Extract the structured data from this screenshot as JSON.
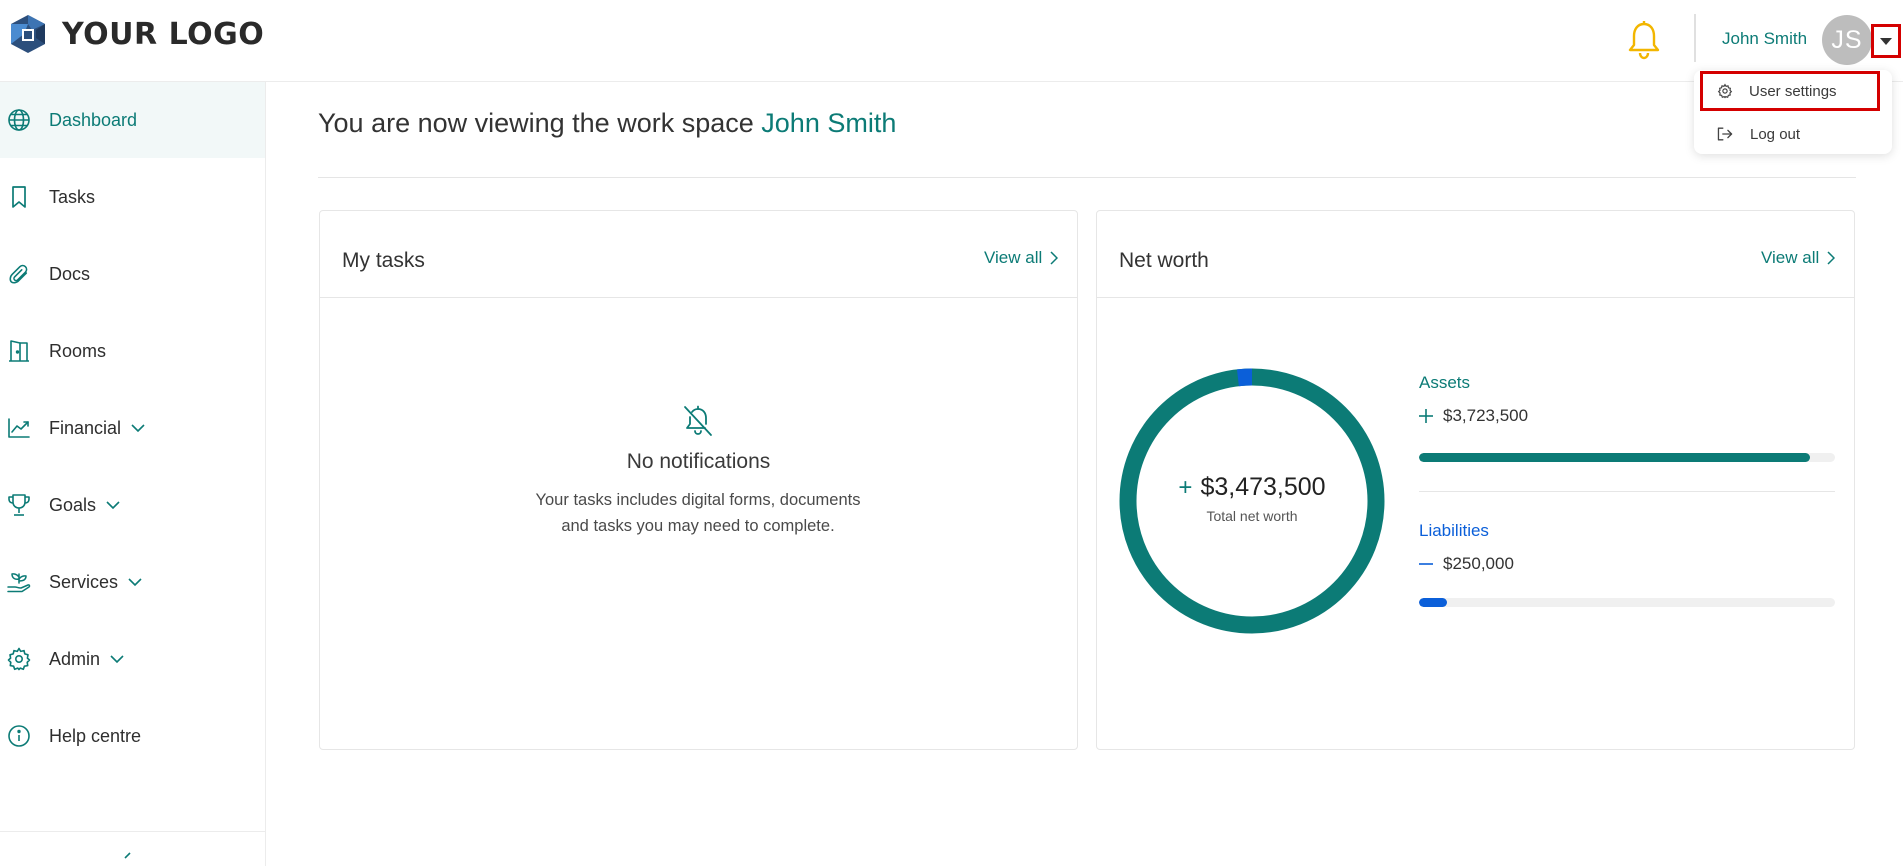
{
  "header": {
    "logo_text": "YOUR LOGO",
    "user_name": "John Smith",
    "avatar_initials": "JS"
  },
  "user_menu": {
    "items": [
      {
        "label": "User settings",
        "icon": "gear-icon"
      },
      {
        "label": "Log out",
        "icon": "logout-icon"
      }
    ]
  },
  "sidebar": {
    "items": [
      {
        "label": "Dashboard",
        "icon": "globe-icon",
        "active": true
      },
      {
        "label": "Tasks",
        "icon": "bookmark-icon"
      },
      {
        "label": "Docs",
        "icon": "paperclip-icon"
      },
      {
        "label": "Rooms",
        "icon": "door-icon"
      },
      {
        "label": "Financial",
        "icon": "chart-line-icon",
        "expandable": true
      },
      {
        "label": "Goals",
        "icon": "trophy-icon",
        "expandable": true
      },
      {
        "label": "Services",
        "icon": "hand-plant-icon",
        "expandable": true
      },
      {
        "label": "Admin",
        "icon": "gear-icon",
        "expandable": true
      },
      {
        "label": "Help centre",
        "icon": "info-icon"
      }
    ]
  },
  "main": {
    "title_prefix": "You are now viewing the work space",
    "workspace_name": "John Smith"
  },
  "tasks_card": {
    "title": "My tasks",
    "view_all": "View all",
    "empty_title": "No notifications",
    "empty_desc": "Your tasks includes digital forms, documents and tasks you may need to complete."
  },
  "networth_card": {
    "title": "Net worth",
    "view_all": "View all",
    "total_value": "$3,473,500",
    "total_label": "Total net worth",
    "assets_label": "Assets",
    "assets_value": "$3,723,500",
    "assets_fraction": 0.94,
    "liabilities_label": "Liabilities",
    "liabilities_value": "$250,000",
    "liabilities_fraction": 0.067
  },
  "colors": {
    "accent": "#0c7b76",
    "liabilities": "#0b5fd9",
    "highlight_border": "#d40000",
    "bell": "#f2b600"
  }
}
